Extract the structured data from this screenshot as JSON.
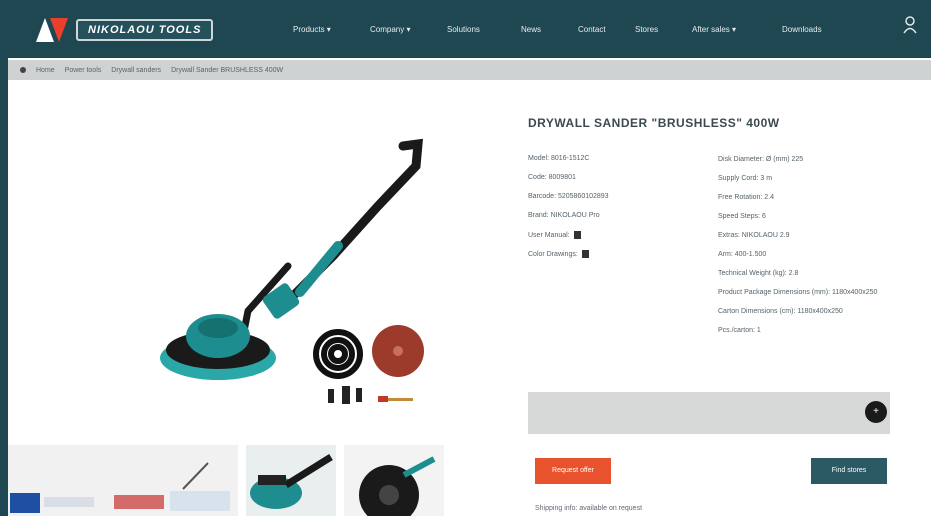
{
  "brand": {
    "name": "NIKOLAOU TOOLS"
  },
  "nav": {
    "items": [
      "Products ▾",
      "Company ▾",
      "Solutions",
      "News",
      "Contact",
      "Stores",
      "After sales ▾",
      "Downloads"
    ],
    "user_icon": "user-icon"
  },
  "breadcrumb": [
    "Home",
    "Power tools",
    "Drywall sanders",
    "Drywall Sander BRUSHLESS 400W"
  ],
  "product": {
    "title": "DRYWALL SANDER \"BRUSHLESS\" 400W",
    "specs_left": [
      "Model: 8016-1512C",
      "Code: 8009801",
      "Barcode: 5205860102893",
      "Brand: NIKOLAOU Pro",
      "User Manual:",
      "Color Drawings:"
    ],
    "specs_right": [
      "Disk Diameter: Ø (mm) 225",
      "Supply Cord: 3 m",
      "Free Rotation: 2.4",
      "Speed Steps: 6",
      "Extras: NIKOLAOU 2.9",
      "Arm: 400-1.500",
      "Technical Weight (kg): 2.8",
      "Product Package Dimensions (mm): 1180x400x250",
      "Carton Dimensions (cm): 1180x400x250",
      "Pcs./carton: 1"
    ],
    "qty_button": "+",
    "buy_label": "Request offer",
    "stores_label": "Find stores",
    "footnote": "Shipping info: available on request"
  },
  "colors": {
    "header": "#1f4752",
    "accent": "#e8532e",
    "dark_button": "#2b5a64"
  }
}
